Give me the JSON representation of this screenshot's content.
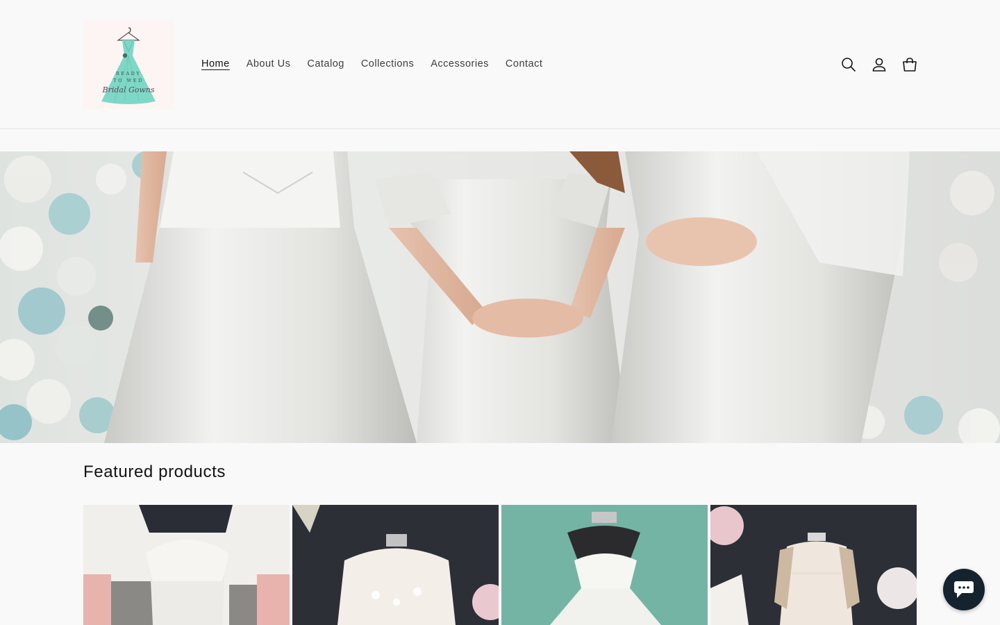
{
  "header": {
    "logo_alt": "Ready To Wed Bridal Gowns",
    "logo_text": {
      "line1": "READY",
      "line2": "TO WED",
      "script": "Bridal Gowns"
    },
    "nav": [
      {
        "label": "Home",
        "active": true
      },
      {
        "label": "About Us",
        "active": false
      },
      {
        "label": "Catalog",
        "active": false
      },
      {
        "label": "Collections",
        "active": false
      },
      {
        "label": "Accessories",
        "active": false
      },
      {
        "label": "Contact",
        "active": false
      }
    ],
    "icons": [
      "search-icon",
      "account-icon",
      "cart-icon"
    ]
  },
  "hero": {
    "image": "three-brides-white-gowns-floral-wall"
  },
  "featured": {
    "title": "Featured products",
    "products": [
      {
        "image": "lace-strapless-mermaid-gown"
      },
      {
        "image": "long-sleeve-lace-gown-dark-backdrop"
      },
      {
        "image": "sweetheart-satin-ballgown-teal-curtain"
      },
      {
        "image": "long-sleeve-sheer-sheath-gown"
      }
    ]
  },
  "chat": {
    "icon": "chat-icon"
  },
  "colors": {
    "background": "#f9f9f9",
    "text": "#121212",
    "nav_text": "#3d3d3d",
    "logo_dress": "#7dd8c6",
    "chat_bg": "#14232e"
  }
}
